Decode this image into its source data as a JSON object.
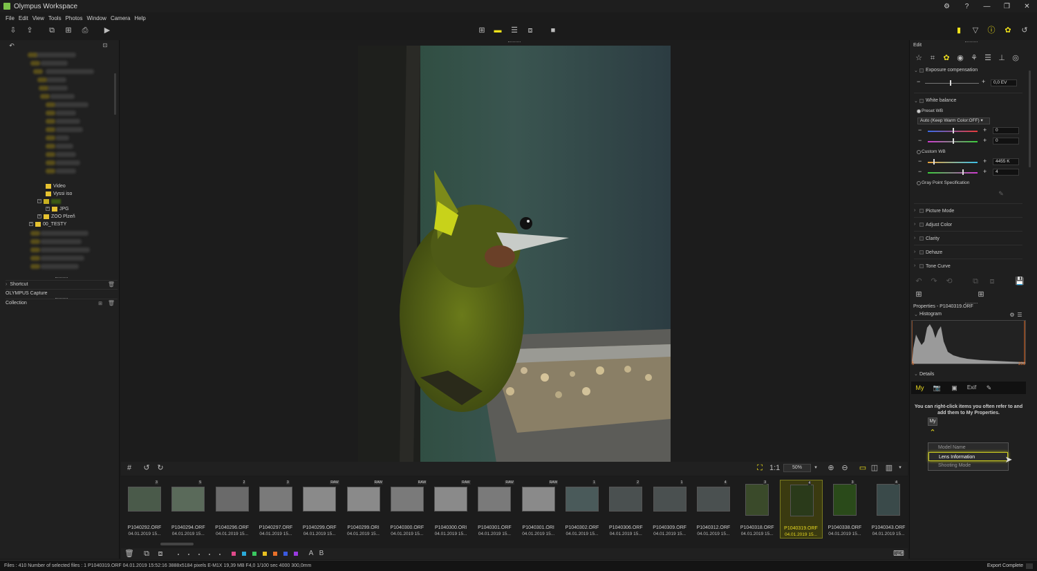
{
  "app": {
    "title": "Olympus Workspace"
  },
  "window_controls": [
    "⚙",
    "?",
    "—",
    "❐",
    "✕"
  ],
  "menu": [
    "File",
    "Edit",
    "View",
    "Tools",
    "Photos",
    "Window",
    "Camera",
    "Help"
  ],
  "tree": {
    "items": [
      {
        "label": "Video"
      },
      {
        "label": "Vyssi iso"
      },
      {
        "label": "JPG"
      },
      {
        "label": "ZOO Plzeň"
      },
      {
        "label": "00_TESTY"
      }
    ]
  },
  "left_panels": {
    "shortcut": "Shortcut",
    "capture": "OLYMPUS Capture",
    "collection": "Collection"
  },
  "viewbar": {
    "zoom": "50%"
  },
  "filmstrip": [
    {
      "name": "P1040292.ORF",
      "date": "04.01.2019 15...",
      "badge": "3"
    },
    {
      "name": "P1040294.ORF",
      "date": "04.01.2019 15...",
      "badge": "5"
    },
    {
      "name": "P1040296.ORF",
      "date": "04.01.2019 15...",
      "badge": "2"
    },
    {
      "name": "P1040297.ORF",
      "date": "04.01.2019 15...",
      "badge": "3"
    },
    {
      "name": "P1040299.ORF",
      "date": "04.01.2019 15...",
      "badge": "RAW"
    },
    {
      "name": "P1040299.ORI",
      "date": "04.01.2019 15...",
      "badge": "RAW"
    },
    {
      "name": "P1040300.ORF",
      "date": "04.01.2019 15...",
      "badge": "RAW"
    },
    {
      "name": "P1040300.ORI",
      "date": "04.01.2019 15...",
      "badge": "RAW"
    },
    {
      "name": "P1040301.ORF",
      "date": "04.01.2019 15...",
      "badge": "RAW"
    },
    {
      "name": "P1040301.ORI",
      "date": "04.01.2019 15...",
      "badge": "RAW"
    },
    {
      "name": "P1040302.ORF",
      "date": "04.01.2019 15...",
      "badge": "1"
    },
    {
      "name": "P1040306.ORF",
      "date": "04.01.2019 15...",
      "badge": "2"
    },
    {
      "name": "P1040309.ORF",
      "date": "04.01.2019 15...",
      "badge": "1"
    },
    {
      "name": "P1040312.ORF",
      "date": "04.01.2019 15...",
      "badge": "4"
    },
    {
      "name": "P1040318.ORF",
      "date": "04.01.2019 15...",
      "badge": "3"
    },
    {
      "name": "P1040319.ORF",
      "date": "04.01.2019 15...",
      "badge": "4"
    },
    {
      "name": "P1040338.ORF",
      "date": "04.01.2019 15...",
      "badge": "3"
    },
    {
      "name": "P1040343.ORF",
      "date": "04.01.2019 15...",
      "badge": "4"
    }
  ],
  "bottombar": {
    "label_a": "A",
    "label_b": "B"
  },
  "status": {
    "text": "Files : 410  Number of selected files : 1  P1040319.ORF  04.01.2019 15:52:16  3888x5184 pixels  E-M1X  19,39 MB  F4,0  1/100 sec  4000  300,0mm",
    "export": "Export Complete"
  },
  "right": {
    "edit_title": "Edit",
    "exposure": {
      "title": "Exposure compensation",
      "value": "0,0 EV"
    },
    "wb": {
      "title": "White balance",
      "preset_label": "Preset WB",
      "preset_value": "Auto (Keep Warm Color:OFF)",
      "preset_v1": "0",
      "preset_v2": "0",
      "custom_label": "Custom WB",
      "custom_v1": "4455 K",
      "custom_v2": "4",
      "gray_label": "Gray Point Specification"
    },
    "sections": [
      "Picture Mode",
      "Adjust Color",
      "Clarity",
      "Dehaze",
      "Tone Curve"
    ],
    "properties_title": "Properties - P1040319.ORF",
    "histogram_title": "Histogram",
    "hist_min": "5",
    "hist_max": "251",
    "details_title": "Details",
    "tab_my": "My",
    "tab_exif": "Exif",
    "hint": "You can right-click items you often refer to and add them to My Properties.",
    "my_button": "My",
    "context_menu": [
      "Model Name",
      "Lens Information",
      "Shooting Mode"
    ]
  }
}
